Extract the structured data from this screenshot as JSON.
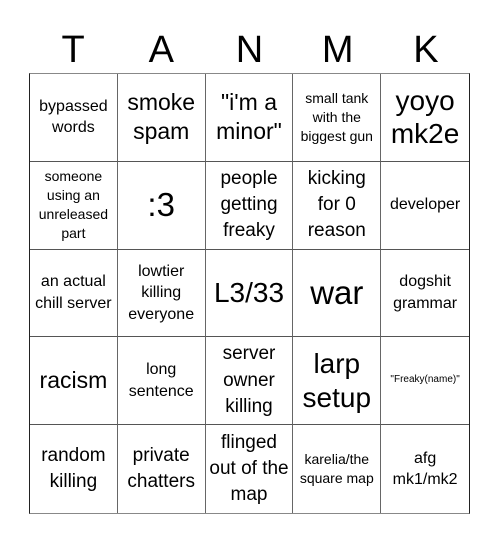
{
  "header": {
    "letters": [
      "T",
      "A",
      "N",
      "M",
      "K"
    ]
  },
  "cells": [
    "bypassed words",
    "smoke spam",
    "\"i'm a minor\"",
    "small tank with the biggest gun",
    "yoyo mk2e",
    "someone using an unreleased part",
    ":3",
    "people getting freaky",
    "kicking for 0 reason",
    "developer",
    "an actual chill server",
    "lowtier killing everyone",
    "L3/33",
    "war",
    "dogshit grammar",
    "racism",
    "long sentence",
    "server owner killing",
    "larp setup",
    "\"Freaky(name)\"",
    "random killing",
    "private chatters",
    "flinged out of the map",
    "karelia/the square map",
    "afg mk1/mk2"
  ]
}
